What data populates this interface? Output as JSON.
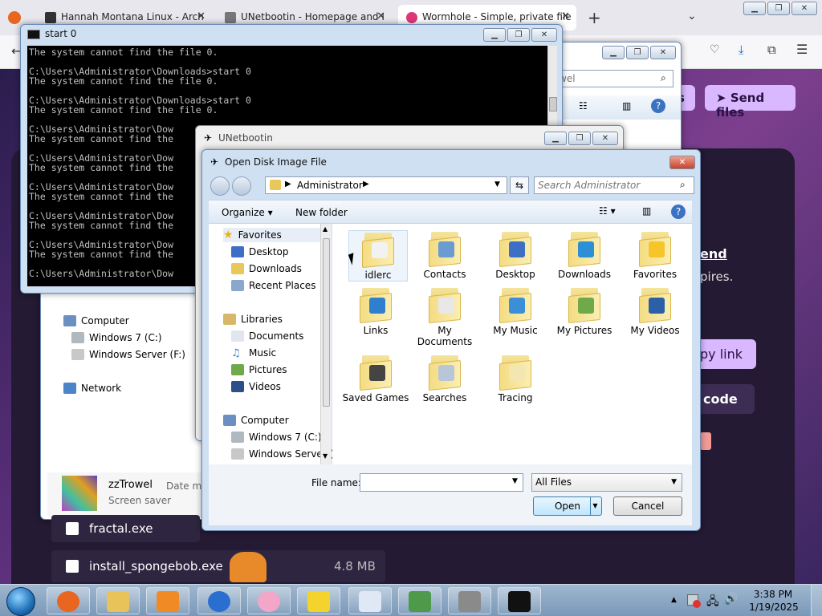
{
  "browser": {
    "tabs": [
      {
        "title": "Hannah Montana Linux - Arch",
        "color": "#333333"
      },
      {
        "title": "UNetbootin - Homepage and I",
        "color": "#555555"
      },
      {
        "title": "Wormhole - Simple, private file",
        "color": "#e0357a"
      }
    ],
    "new_tab": "+",
    "wormhole": {
      "send_files": "Send files",
      "link_fragment": "end",
      "expires_fragment": "pires.",
      "copy_link": "py link",
      "code": "code",
      "s_button": "s"
    }
  },
  "cmd": {
    "title": "start  0",
    "lines": [
      "The system cannot find the file 0.",
      "",
      "C:\\Users\\Administrator\\Downloads>start 0",
      "The system cannot find the file 0.",
      "",
      "C:\\Users\\Administrator\\Downloads>start 0",
      "The system cannot find the file 0.",
      "",
      "C:\\Users\\Administrator\\Dow",
      "The system cannot find the",
      "",
      "C:\\Users\\Administrator\\Dow",
      "The system cannot find the",
      "",
      "C:\\Users\\Administrator\\Dow",
      "The system cannot find the",
      "",
      "C:\\Users\\Administrator\\Dow",
      "The system cannot find the",
      "",
      "C:\\Users\\Administrator\\Dow",
      "The system cannot find the",
      "",
      "C:\\Users\\Administrator\\Dow"
    ]
  },
  "explorer": {
    "search_placeholder": "wel",
    "nav": {
      "computer": "Computer",
      "drive_c": "Windows 7 (C:)",
      "drive_f": "Windows Server (F:)",
      "network": "Network"
    },
    "file": {
      "name": "zzTrowel",
      "type": "Screen saver",
      "date_label": "Date mo"
    },
    "downloads": [
      {
        "name": "fractal.exe",
        "size": ""
      },
      {
        "name": "install_spongebob.exe",
        "size": "4.8 MB"
      }
    ]
  },
  "unetbootin": {
    "title": "UNetbootin"
  },
  "dialog": {
    "title": "Open Disk Image File",
    "breadcrumb": "Administrator",
    "search_placeholder": "Search Administrator",
    "organize": "Organize",
    "new_folder": "New folder",
    "nav": {
      "favorites": "Favorites",
      "desktop": "Desktop",
      "downloads": "Downloads",
      "recent": "Recent Places",
      "libraries": "Libraries",
      "documents": "Documents",
      "music": "Music",
      "pictures": "Pictures",
      "videos": "Videos",
      "computer": "Computer",
      "drive_c": "Windows 7 (C:)",
      "drive_f": "Windows Server ("
    },
    "folders": [
      {
        "name": "idlerc",
        "color": "#f2f2f2"
      },
      {
        "name": "Contacts",
        "color": "#6a9bd1"
      },
      {
        "name": "Desktop",
        "color": "#3d6fc4"
      },
      {
        "name": "Downloads",
        "color": "#2d8fd6"
      },
      {
        "name": "Favorites",
        "color": "#f5c52a"
      },
      {
        "name": "Links",
        "color": "#2f7fd0"
      },
      {
        "name": "My Documents",
        "color": "#e8e8e8"
      },
      {
        "name": "My Music",
        "color": "#3b8fd9"
      },
      {
        "name": "My Pictures",
        "color": "#6fa94a"
      },
      {
        "name": "My Videos",
        "color": "#2b5fa8"
      },
      {
        "name": "Saved Games",
        "color": "#444444"
      },
      {
        "name": "Searches",
        "color": "#b7c7d8"
      },
      {
        "name": "Tracing",
        "color": "#f3e6b0"
      }
    ],
    "filename_label": "File name:",
    "filename_value": "",
    "filter": "All Files",
    "open": "Open",
    "cancel": "Cancel"
  },
  "taskbar": {
    "time": "3:38 PM",
    "date": "1/19/2025",
    "apps": [
      {
        "name": "firefox",
        "color": "#e8661f"
      },
      {
        "name": "explorer",
        "color": "#e8c35a"
      },
      {
        "name": "media-player",
        "color": "#f08a24"
      },
      {
        "name": "thunderbird",
        "color": "#2a6fd0"
      },
      {
        "name": "piglet",
        "color": "#f2a6c8"
      },
      {
        "name": "spongebob",
        "color": "#f4d32c"
      },
      {
        "name": "notepad",
        "color": "#dfe8f4"
      },
      {
        "name": "python-idle",
        "color": "#4c9a4a"
      },
      {
        "name": "unetbootin",
        "color": "#8a8a8a"
      },
      {
        "name": "cmd",
        "color": "#111111"
      }
    ]
  }
}
